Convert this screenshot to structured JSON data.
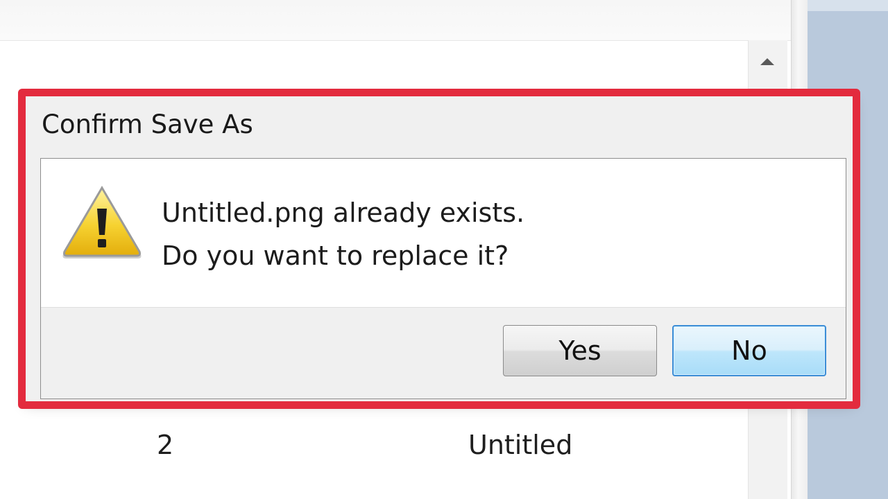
{
  "dialog": {
    "title": "Confirm Save As",
    "message_line1": "Untitled.png already exists.",
    "message_line2": "Do you want to replace it?",
    "icon": "warning-icon",
    "yes_label": "Yes",
    "no_label": "No",
    "default_button": "No"
  },
  "background": {
    "row_number": "2",
    "row_name": "Untitled"
  },
  "colors": {
    "highlight": "#e32b3e",
    "default_button_border": "#3c8dd6",
    "warning_yellow": "#f3c51a"
  }
}
